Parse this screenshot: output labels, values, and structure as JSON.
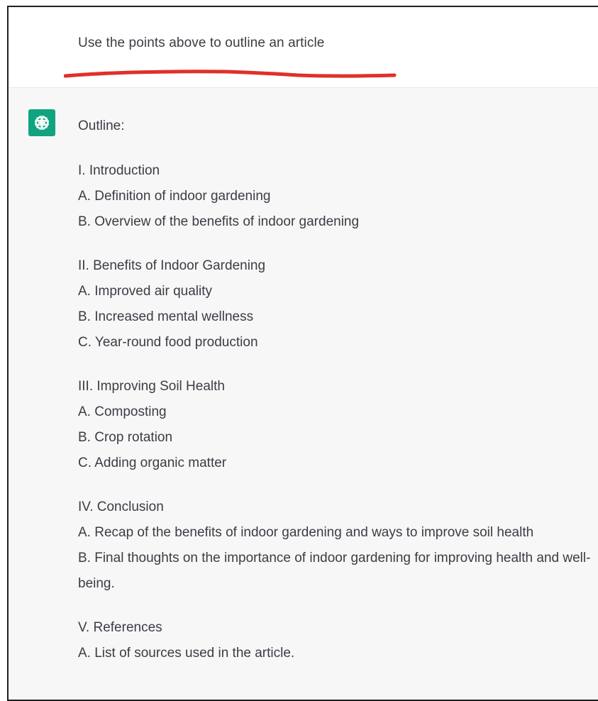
{
  "user_message": {
    "text": "Use the points above to outline an article"
  },
  "assistant_message": {
    "intro": "Outline:",
    "sections": [
      {
        "heading": "I. Introduction",
        "items": [
          "A. Definition of indoor gardening",
          "B. Overview of the benefits of indoor gardening"
        ]
      },
      {
        "heading": "II. Benefits of Indoor Gardening",
        "items": [
          "A. Improved air quality",
          "B. Increased mental wellness",
          "C. Year-round food production"
        ]
      },
      {
        "heading": "III. Improving Soil Health",
        "items": [
          "A. Composting",
          "B. Crop rotation",
          "C. Adding organic matter"
        ]
      },
      {
        "heading": "IV. Conclusion",
        "items": [
          "A. Recap of the benefits of indoor gardening and ways to improve soil health",
          "B. Final thoughts on the importance of indoor gardening for improving health and well-being."
        ]
      },
      {
        "heading": "V. References",
        "items": [
          "A. List of sources used in the article."
        ]
      }
    ]
  },
  "icons": {
    "assistant_avatar": "openai-logo-icon",
    "underline": "red-underline-annotation"
  },
  "colors": {
    "avatar_bg": "#10a37f",
    "assistant_bg": "#f7f7f8",
    "text": "#3c3c44",
    "underline": "#e0302a",
    "frame_border": "#1f1f1f"
  }
}
